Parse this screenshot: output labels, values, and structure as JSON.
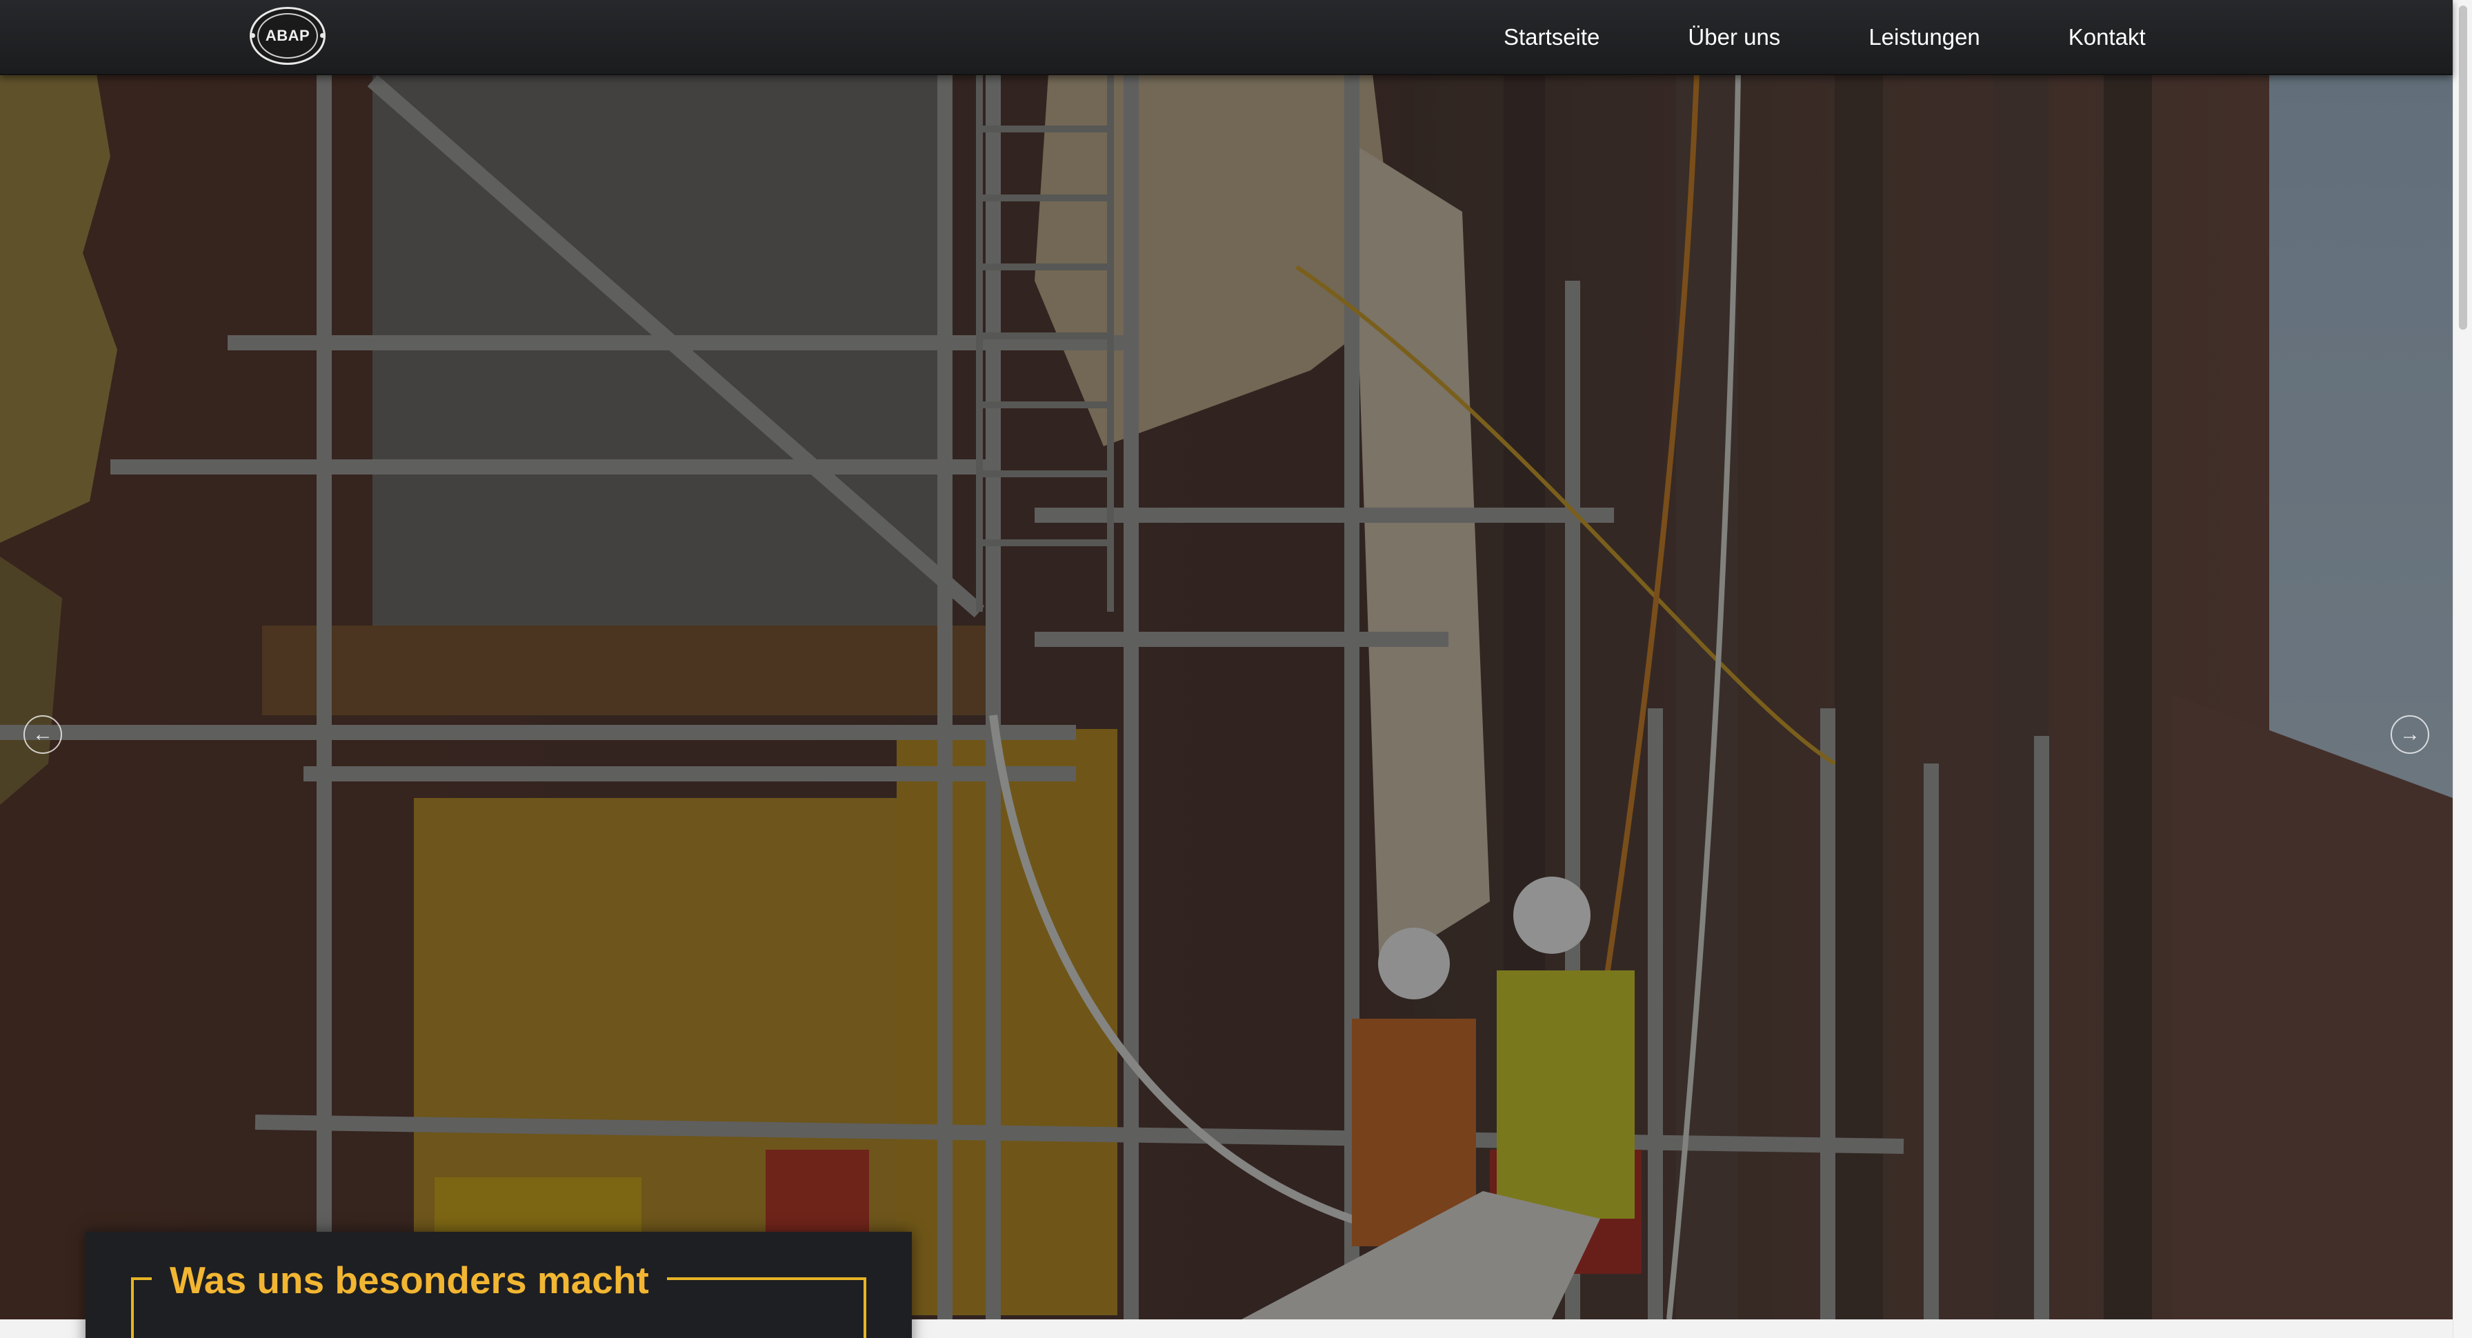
{
  "brand": {
    "logo_text": "ABAP"
  },
  "nav": {
    "items": [
      {
        "label": "Startseite"
      },
      {
        "label": "Über uns"
      },
      {
        "label": "Leistungen"
      },
      {
        "label": "Kontakt"
      }
    ]
  },
  "hero": {
    "prev_icon": "arrow-left-icon",
    "next_icon": "arrow-right-icon",
    "prev_glyph": "←",
    "next_glyph": "→"
  },
  "info": {
    "title": "Was uns besonders macht",
    "body": ""
  },
  "colors": {
    "navbar": "#1f2023",
    "accent": "#f2b632",
    "card": "#1e1f22"
  }
}
